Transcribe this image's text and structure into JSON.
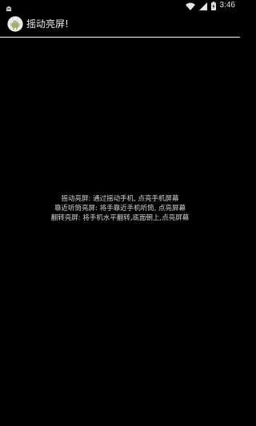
{
  "status_bar": {
    "time": "3:46",
    "left_icon": "usb-debug-icon",
    "right_icons": [
      "wifi-icon",
      "signal-icon",
      "battery-icon"
    ]
  },
  "app_bar": {
    "title": "摇动亮屏!",
    "icon": "android-robot-icon"
  },
  "content": {
    "lines": [
      "摇动亮屏: 通过摇动手机, 点亮手机屏幕",
      "靠近听筒亮屏: 将手靠近手机听筒, 点亮屏幕",
      "翻转亮屏: 将手机水平翻转,底面朝上,点亮屏幕"
    ]
  },
  "colors": {
    "background": "#000000",
    "text": "#d6d6d6",
    "divider": "#ffffff"
  }
}
